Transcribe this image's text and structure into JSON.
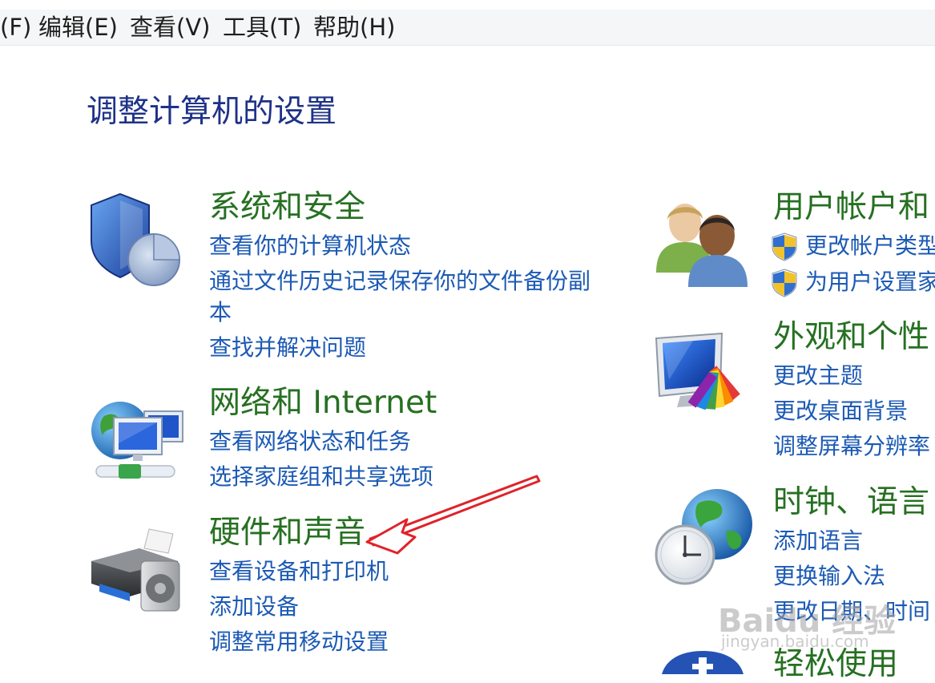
{
  "menubar": {
    "items": [
      "(F)",
      "编辑(E)",
      "查看(V)",
      "工具(T)",
      "帮助(H)"
    ]
  },
  "page": {
    "title": "调整计算机的设置"
  },
  "categories": {
    "system_security": {
      "title": "系统和安全",
      "links": [
        "查看你的计算机状态",
        "通过文件历史记录保存你的文件备份副",
        "本",
        "查找并解决问题"
      ]
    },
    "network": {
      "title": "网络和 Internet",
      "links": [
        "查看网络状态和任务",
        "选择家庭组和共享选项"
      ]
    },
    "hardware": {
      "title": "硬件和声音",
      "links": [
        "查看设备和打印机",
        "添加设备",
        "调整常用移动设置"
      ]
    },
    "user_accounts": {
      "title": "用户帐户和",
      "links": [
        "更改帐户类型",
        "为用户设置家"
      ]
    },
    "appearance": {
      "title": "外观和个性",
      "links": [
        "更改主题",
        "更改桌面背景",
        "调整屏幕分辨率"
      ]
    },
    "clock_language": {
      "title": "时钟、语言",
      "links": [
        "添加语言",
        "更换输入法",
        "更改日期、时间"
      ]
    },
    "ease_access": {
      "title": "轻松使用"
    }
  },
  "watermark": {
    "logo": "Baidu 经验",
    "url": "jingyan.baidu.com"
  },
  "colors": {
    "title": "#1e3287",
    "category": "#267021",
    "link": "#1c5ab4",
    "annotation_arrow": "#e0222a"
  },
  "icons": [
    "shield-pie-icon",
    "network-globe-icon",
    "printer-speaker-icon",
    "users-icon",
    "monitor-palette-icon",
    "globe-clock-icon",
    "uac-shield-icon",
    "ease-access-icon",
    "annotation-arrow"
  ]
}
